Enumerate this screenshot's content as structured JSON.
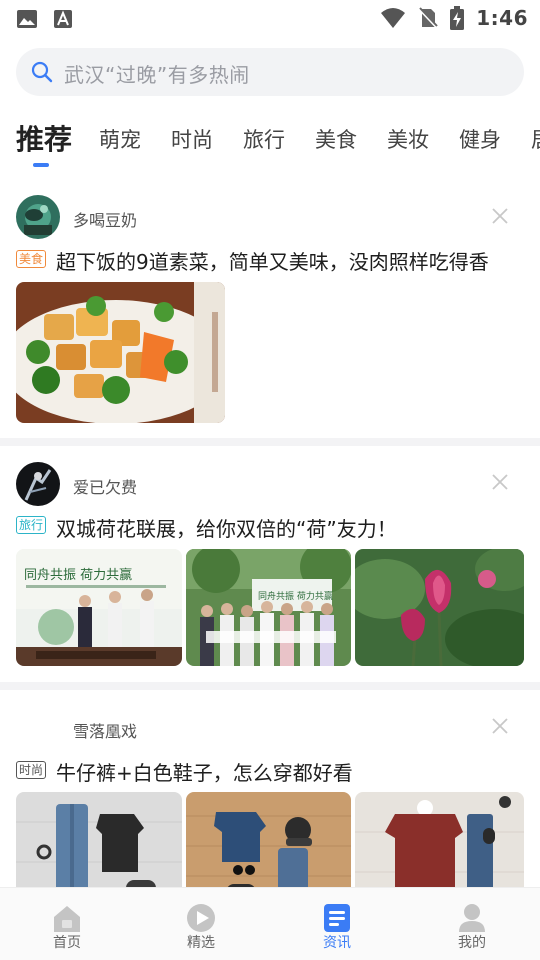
{
  "status_bar": {
    "time": "1:46",
    "icons": [
      "image-icon",
      "font-icon",
      "wifi-icon",
      "no-sim-icon",
      "battery-charging-icon"
    ]
  },
  "search": {
    "placeholder": "武汉“过晚”有多热闹"
  },
  "tabs": [
    {
      "label": "推荐",
      "active": true
    },
    {
      "label": "萌宠"
    },
    {
      "label": "时尚"
    },
    {
      "label": "旅行"
    },
    {
      "label": "美食"
    },
    {
      "label": "美妆"
    },
    {
      "label": "健身"
    },
    {
      "label": "居"
    }
  ],
  "feed": [
    {
      "author": "多喝豆奶",
      "tag": "美食",
      "tag_color": "#f08a3c",
      "title": "超下饭的9道素菜，简单又美味，没肉照样吃得香",
      "images": [
        "tofu-broccoli-dish"
      ]
    },
    {
      "author": "爱已欠费",
      "tag": "旅行",
      "tag_color": "#2cb4c8",
      "title": "双城荷花联展，给你双倍的“荷”友力！",
      "images": [
        "lotus-exhibition-stage",
        "lotus-exhibition-group-photo",
        "pink-lotus-buds"
      ],
      "image_texts": [
        "同舟共振 荷力共赢",
        "同舟共振 荷力共赢"
      ]
    },
    {
      "author": "雪落凰戏",
      "tag": "时尚",
      "tag_color": "#555555",
      "title": "牛仔裤+白色鞋子，怎么穿都好看",
      "images": [
        "outfit-black-tee-jeans",
        "outfit-navy-tee-jeans",
        "outfit-red-sweater-jeans"
      ]
    }
  ],
  "bottom_nav": [
    {
      "label": "首页",
      "icon": "home-icon"
    },
    {
      "label": "精选",
      "icon": "play-icon"
    },
    {
      "label": "资讯",
      "icon": "news-icon",
      "active": true
    },
    {
      "label": "我的",
      "icon": "profile-icon"
    }
  ],
  "colors": {
    "accent": "#3b7cf5",
    "nav_inactive": "#c4c4c4"
  }
}
